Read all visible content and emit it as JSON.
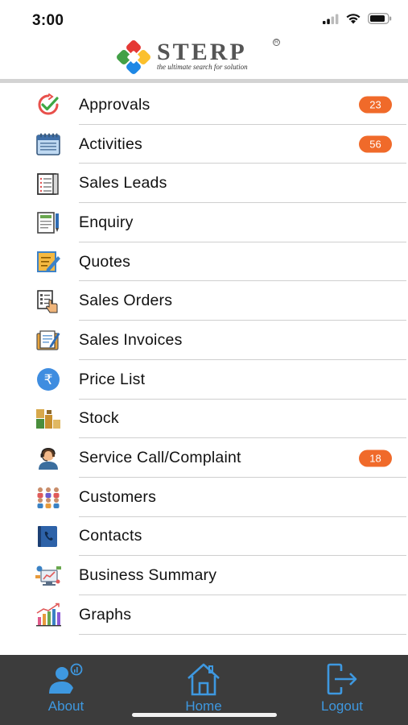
{
  "status": {
    "time": "3:00"
  },
  "logo": {
    "name": "STERP",
    "tagline": "the ultimate search for solution"
  },
  "menu": [
    {
      "label": "Approvals",
      "icon": "approval-check-icon",
      "badge": "23"
    },
    {
      "label": "Activities",
      "icon": "calendar-icon",
      "badge": "56"
    },
    {
      "label": "Sales Leads",
      "icon": "clipboard-icon",
      "badge": ""
    },
    {
      "label": "Enquiry",
      "icon": "enquiry-form-icon",
      "badge": ""
    },
    {
      "label": "Quotes",
      "icon": "quote-edit-icon",
      "badge": ""
    },
    {
      "label": "Sales Orders",
      "icon": "order-touch-icon",
      "badge": ""
    },
    {
      "label": "Sales Invoices",
      "icon": "invoice-icon",
      "badge": ""
    },
    {
      "label": "Price List",
      "icon": "rupee-icon",
      "badge": ""
    },
    {
      "label": "Stock",
      "icon": "stock-boxes-icon",
      "badge": ""
    },
    {
      "label": "Service Call/Complaint",
      "icon": "support-agent-icon",
      "badge": "18"
    },
    {
      "label": "Customers",
      "icon": "customers-icon",
      "badge": ""
    },
    {
      "label": "Contacts",
      "icon": "contact-book-icon",
      "badge": ""
    },
    {
      "label": "Business Summary",
      "icon": "business-summary-icon",
      "badge": ""
    },
    {
      "label": "Graphs",
      "icon": "bar-graph-icon",
      "badge": ""
    }
  ],
  "tabs": {
    "about": "About",
    "home": "Home",
    "logout": "Logout"
  },
  "colors": {
    "accent": "#3e98e0",
    "badge": "#f06a2a",
    "tabbar": "#3c3c3c"
  }
}
